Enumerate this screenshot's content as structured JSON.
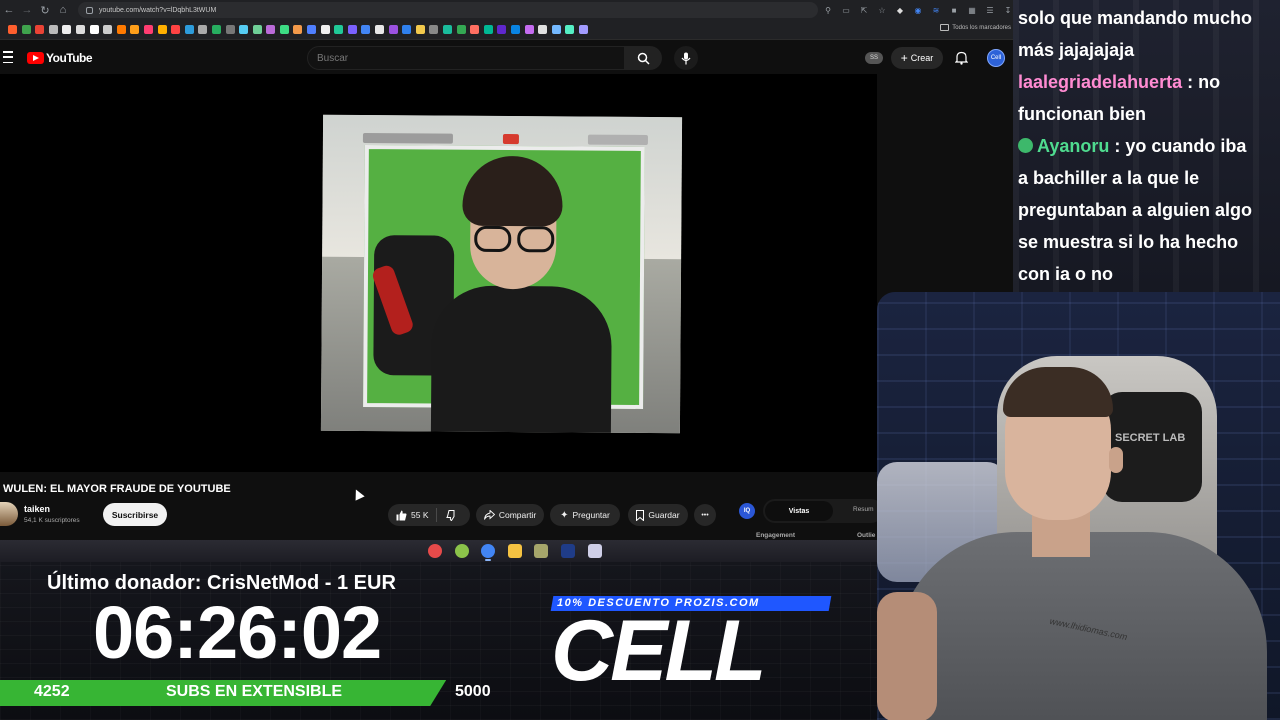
{
  "browser": {
    "url": "youtube.com/watch?v=lDqbhL3tWUM",
    "bookmarks_folder": "Todos los marcadores",
    "bookmark_colors": [
      "#ff5f2e",
      "#3fa34d",
      "#ea4335",
      "#bbbbbb",
      "#eeeeee",
      "#dddddd",
      "#ffffff",
      "#cccccc",
      "#ff7a00",
      "#ff9f1a",
      "#ff3d71",
      "#ffb000",
      "#ff4343",
      "#2d9cdb",
      "#aaaaaa",
      "#27ae60",
      "#777777",
      "#56ccf2",
      "#6fcf97",
      "#bb6bd9",
      "#3ddc84",
      "#f2994a",
      "#4f7fff",
      "#eeeeee",
      "#20c997",
      "#7b61ff",
      "#4285f4",
      "#e8e8e8",
      "#9b51e0",
      "#2f80ed",
      "#f2c94c",
      "#888888",
      "#1abc9c",
      "#34a853",
      "#ff6f61",
      "#00b894",
      "#5f27cd",
      "#0984e3",
      "#c56cf0",
      "#e0e0e0",
      "#74b9ff",
      "#55efc4",
      "#a29bfe"
    ]
  },
  "youtube": {
    "logo_text": "YouTube",
    "search_placeholder": "Buscar",
    "ss_badge": "SS",
    "create_label": "Crear",
    "avatar_text": "Cell",
    "video": {
      "title": "WULEN: EL MAYOR FRAUDE DE YOUTUBE",
      "channel_name": "taiken",
      "channel_subs": "54,1 K suscriptores",
      "subscribe_label": "Suscribirse",
      "likes": "55 K",
      "share_label": "Compartir",
      "ask_label": "Preguntar",
      "save_label": "Guardar",
      "more_label": "•••"
    },
    "tool_panel": {
      "icon_text": "IQ",
      "tab_active": "Vistas",
      "tab_inactive": "Resum",
      "label_engagement": "Engagement",
      "label_outlier": "Outlie"
    }
  },
  "taskbar": {
    "icon_colors": [
      "#e64a4a",
      "#8bc34a",
      "#4285f4",
      "#f5c242",
      "#a5a56b",
      "#1f3c88",
      "#cfcfe8"
    ]
  },
  "overlay": {
    "donor_text": "Último donador: CrisNetMod - 1 EUR",
    "timer": "06:26:02",
    "subs_current": "4252",
    "subs_label": "SUBS EN EXTENSIBLE",
    "subs_goal": "5000",
    "subs_progress": 0.8504,
    "promo_text": "10% DESCUENTO PROZIS.COM",
    "brand_text": "CELL",
    "accent_green": "#37b534",
    "accent_blue": "#1f57ff"
  },
  "chat": {
    "messages": [
      {
        "user": "",
        "text": "solo que mandando mucho"
      },
      {
        "user": "",
        "text": "más jajajajaja"
      },
      {
        "user": "laalegriadelahuerta",
        "text": ": no"
      },
      {
        "user": "",
        "text": "funcionan bien"
      },
      {
        "user": "Ayanoru",
        "text": ": yo cuando iba"
      },
      {
        "user": "",
        "text": "a bachiller a la que le"
      },
      {
        "user": "",
        "text": "preguntaban a alguien algo"
      },
      {
        "user": "",
        "text": "se muestra si lo ha hecho"
      },
      {
        "user": "",
        "text": "con ia o no"
      }
    ]
  },
  "webcam": {
    "chair_logo": "SECRET LAB",
    "shirt_text": "www.lhidiomas.com"
  }
}
